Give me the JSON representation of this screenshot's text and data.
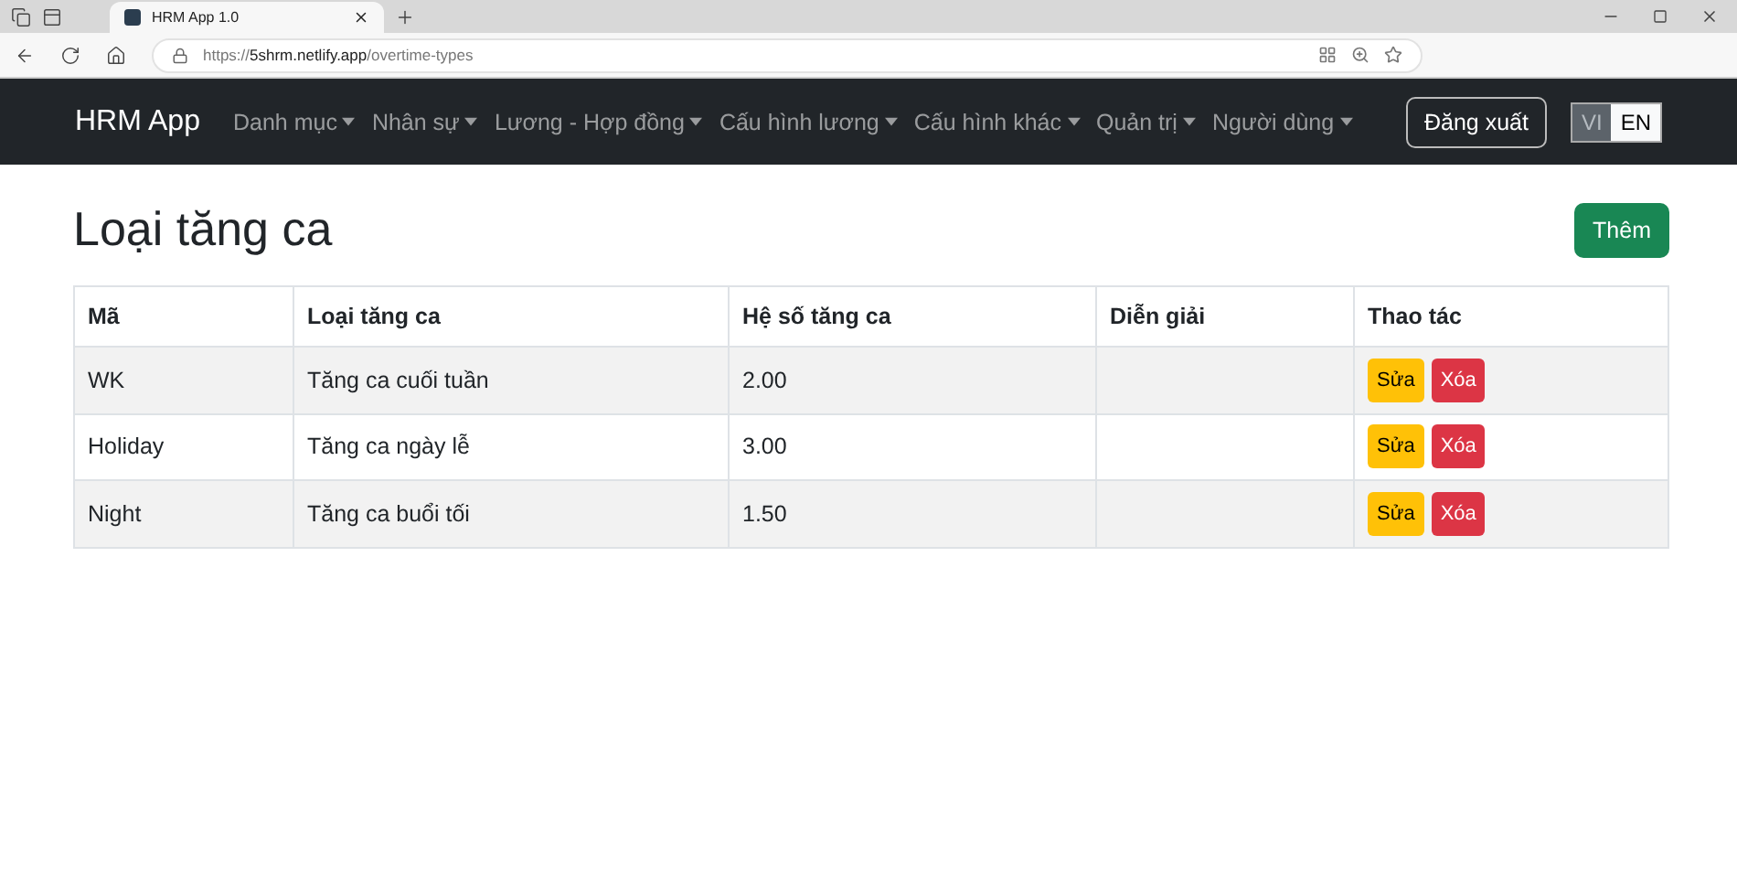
{
  "browser": {
    "tab_title": "HRM App 1.0",
    "url": {
      "scheme": "https://",
      "host": "5shrm.netlify.app",
      "path": "/overtime-types"
    }
  },
  "navbar": {
    "brand": "HRM App",
    "menus": [
      {
        "label": "Danh mục"
      },
      {
        "label": "Nhân sự"
      },
      {
        "label": "Lương - Hợp đồng"
      },
      {
        "label": "Cấu hình lương"
      },
      {
        "label": "Cấu hình khác"
      },
      {
        "label": "Quản trị"
      },
      {
        "label": "Người dùng"
      }
    ],
    "logout": "Đăng xuất",
    "languages": [
      {
        "label": "VI",
        "selected": false
      },
      {
        "label": "EN",
        "selected": true
      }
    ]
  },
  "page": {
    "title": "Loại tăng ca",
    "add_button": "Thêm"
  },
  "table": {
    "columns": [
      "Mã",
      "Loại tăng ca",
      "Hệ số tăng ca",
      "Diễn giải",
      "Thao tác"
    ],
    "rows": [
      {
        "code": "WK",
        "name": "Tăng ca cuối tuần",
        "factor": "2.00",
        "actions": [
          "Sửa",
          "Xóa"
        ]
      },
      {
        "code": "Holiday",
        "name": "Tăng ca ngày lễ",
        "factor": "3.00",
        "actions": [
          "Sửa",
          "Xóa"
        ]
      },
      {
        "code": "Night",
        "name": "Tăng ca buổi tối",
        "factor": "1.50",
        "actions": [
          "Sửa",
          "Xóa"
        ]
      }
    ]
  }
}
